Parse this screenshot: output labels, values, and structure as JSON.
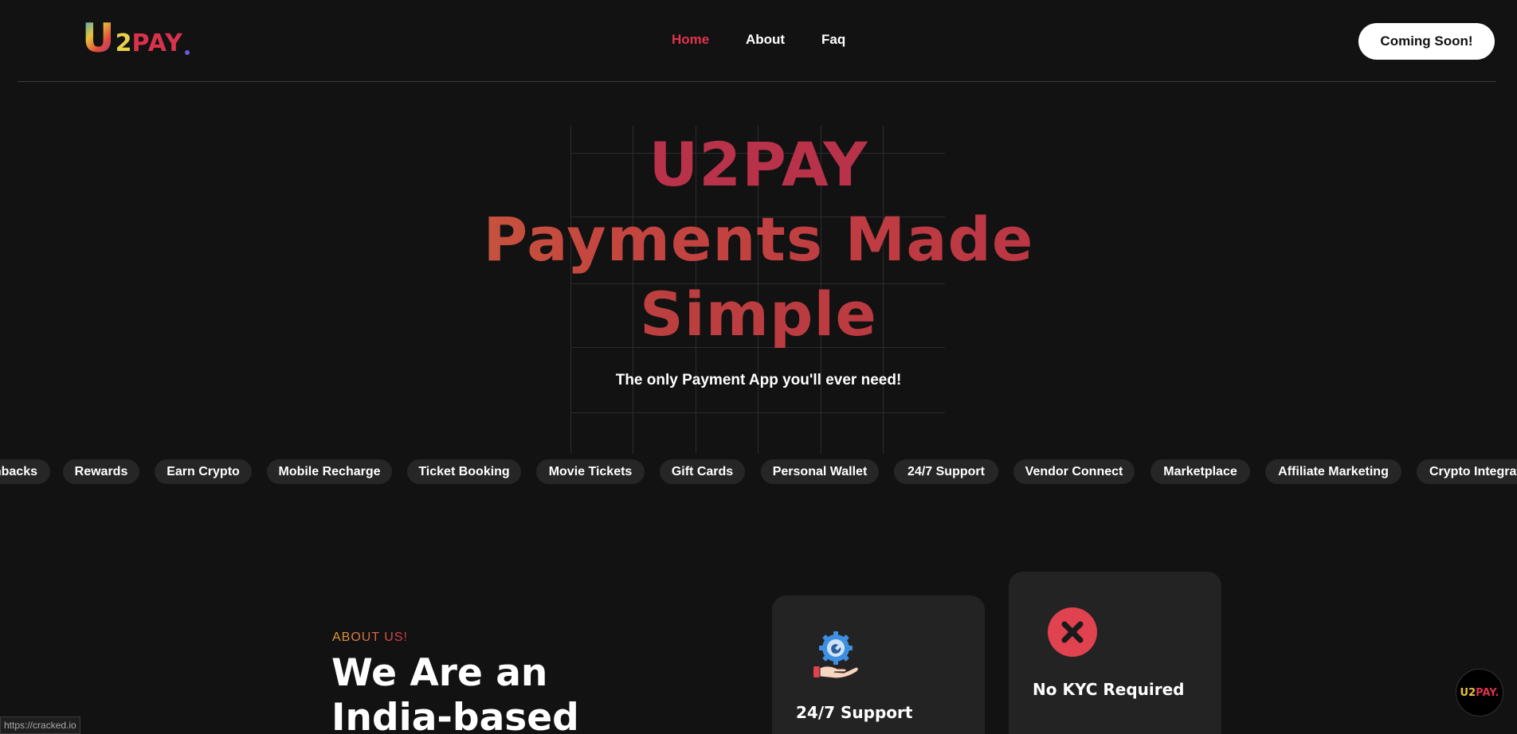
{
  "logo": {
    "u": "U",
    "two": "2",
    "pay": "PAY"
  },
  "nav": {
    "home": "Home",
    "about": "About",
    "faq": "Faq"
  },
  "header": {
    "cta_label": "Coming Soon!"
  },
  "hero": {
    "line1": "U2PAY",
    "line2": "Payments Made",
    "line3": "Simple",
    "tagline": "The only Payment App you'll ever need!"
  },
  "features": [
    "Cashbacks",
    "Rewards",
    "Earn Crypto",
    "Mobile Recharge",
    "Ticket Booking",
    "Movie Tickets",
    "Gift Cards",
    "Personal Wallet",
    "24/7 Support",
    "Vendor Connect",
    "Marketplace",
    "Affiliate Marketing",
    "Crypto Integration"
  ],
  "about": {
    "label": "ABOUT US!",
    "title_line1": "We Are an",
    "title_line2": "India-based"
  },
  "cards": {
    "support": {
      "title": "24/7 Support",
      "icon": "support-hand-gear-icon"
    },
    "kyc": {
      "title": "No KYC Required",
      "icon": "close-circle-icon"
    }
  },
  "status_bar": {
    "url": "https://cracked.io"
  },
  "floating_logo": {
    "u": "U",
    "two": "2",
    "pay": "PAY."
  },
  "colors": {
    "background": "#121212",
    "accent": "#e0334e",
    "card": "#232323",
    "chip": "#262626"
  }
}
